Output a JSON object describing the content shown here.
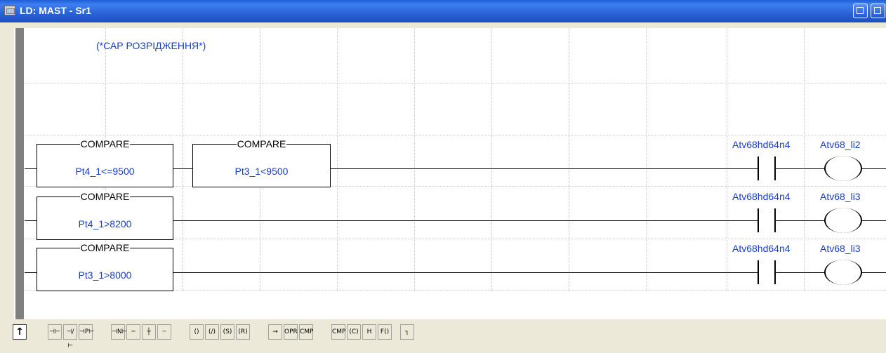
{
  "window": {
    "title": "LD: MAST - Sr1"
  },
  "comment": "(*САР РОЗРІДЖЕННЯ*)",
  "rungs": [
    {
      "compares": [
        {
          "title": "COMPARE",
          "expression": "Pt4_1<=9500"
        },
        {
          "title": "COMPARE",
          "expression": "Pt3_1<9500"
        }
      ],
      "contact": "Atv68hd64n4",
      "coil": "Atv68_li2"
    },
    {
      "compares": [
        {
          "title": "COMPARE",
          "expression": "Pt4_1>8200"
        }
      ],
      "contact": "Atv68hd64n4",
      "coil": "Atv68_li3"
    },
    {
      "compares": [
        {
          "title": "COMPARE",
          "expression": "Pt3_1>8000"
        }
      ],
      "contact": "Atv68hd64n4",
      "coil": "Atv68_li3"
    }
  ],
  "toolbar": {
    "select_tool": "↑",
    "tools": [
      {
        "icon": "normally-open-contact-icon",
        "glyph": "⊣⊢"
      },
      {
        "icon": "normally-closed-contact-icon",
        "glyph": "⊣/⊢"
      },
      {
        "icon": "positive-transition-contact-icon",
        "glyph": "⊣P⊢"
      },
      {
        "icon": "negative-transition-contact-icon",
        "glyph": "⊣N⊢"
      },
      {
        "icon": "horizontal-link-icon",
        "glyph": "─"
      },
      {
        "icon": "vertical-link-icon",
        "glyph": "┼"
      },
      {
        "icon": "horizontal-fill-icon",
        "glyph": "┄"
      },
      {
        "icon": "coil-icon",
        "glyph": "()"
      },
      {
        "icon": "inverse-coil-icon",
        "glyph": "(/)"
      },
      {
        "icon": "set-coil-icon",
        "glyph": "(S)"
      },
      {
        "icon": "reset-coil-icon",
        "glyph": "(R)"
      },
      {
        "icon": "jump-icon",
        "glyph": "→"
      },
      {
        "icon": "operate-block-icon",
        "glyph": "OPR"
      },
      {
        "icon": "compare-block-icon",
        "glyph": "CMP"
      },
      {
        "icon": "compare-block-vertical-icon",
        "glyph": "CMP"
      },
      {
        "icon": "call-coil-icon",
        "glyph": "(C)"
      },
      {
        "icon": "halt-coil-icon",
        "glyph": "H"
      },
      {
        "icon": "function-coil-icon",
        "glyph": "F()"
      },
      {
        "icon": "return-icon",
        "glyph": "┐"
      }
    ]
  }
}
